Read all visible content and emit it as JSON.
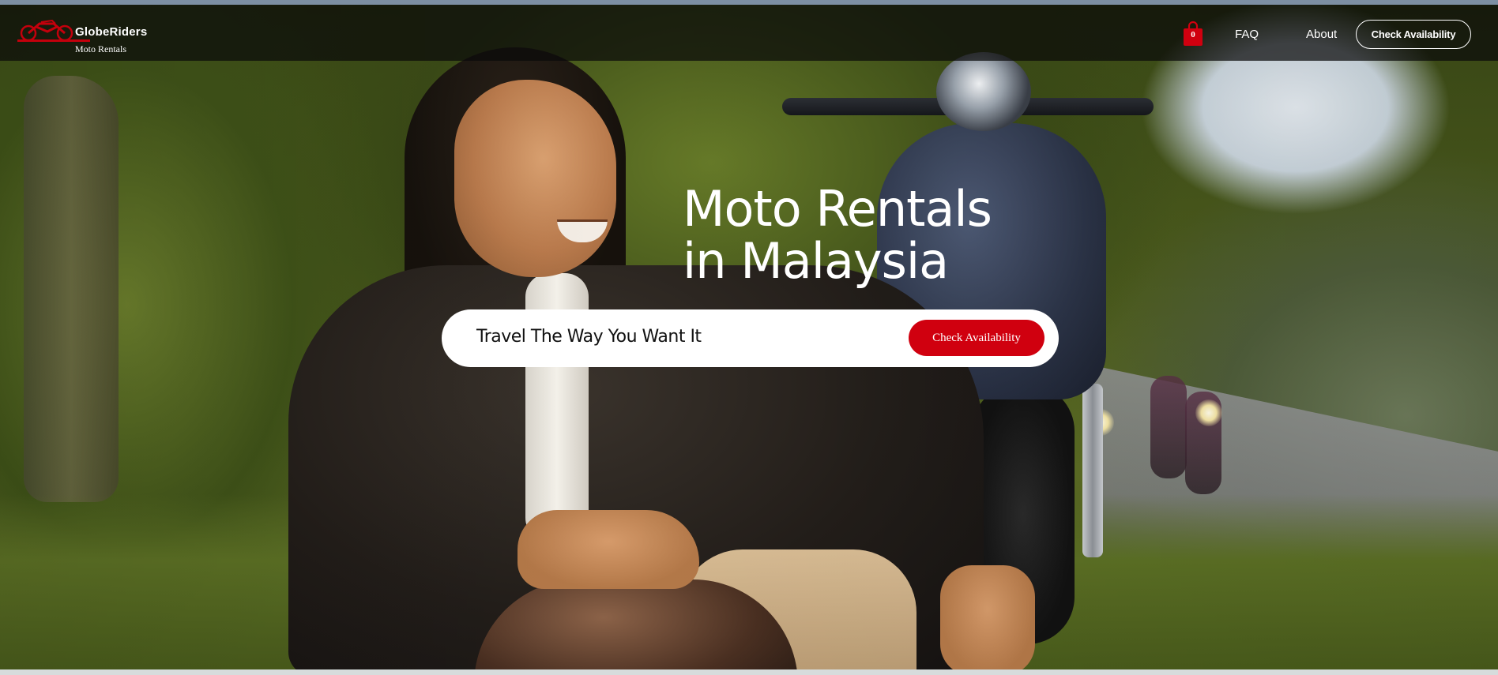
{
  "brand": {
    "name": "GlobeRiders",
    "subtitle": "Moto Rentals",
    "accent_color": "#d0000f"
  },
  "header": {
    "cart": {
      "icon": "shopping-bag-icon",
      "count": "0"
    },
    "nav": [
      {
        "label": "FAQ"
      },
      {
        "label": "About"
      }
    ],
    "cta_label": "Check Availability"
  },
  "hero": {
    "title_line1": "Moto Rentals",
    "title_line2": "in Malaysia",
    "tagline": "Travel The Way You Want It",
    "cta_label": "Check Availability"
  }
}
